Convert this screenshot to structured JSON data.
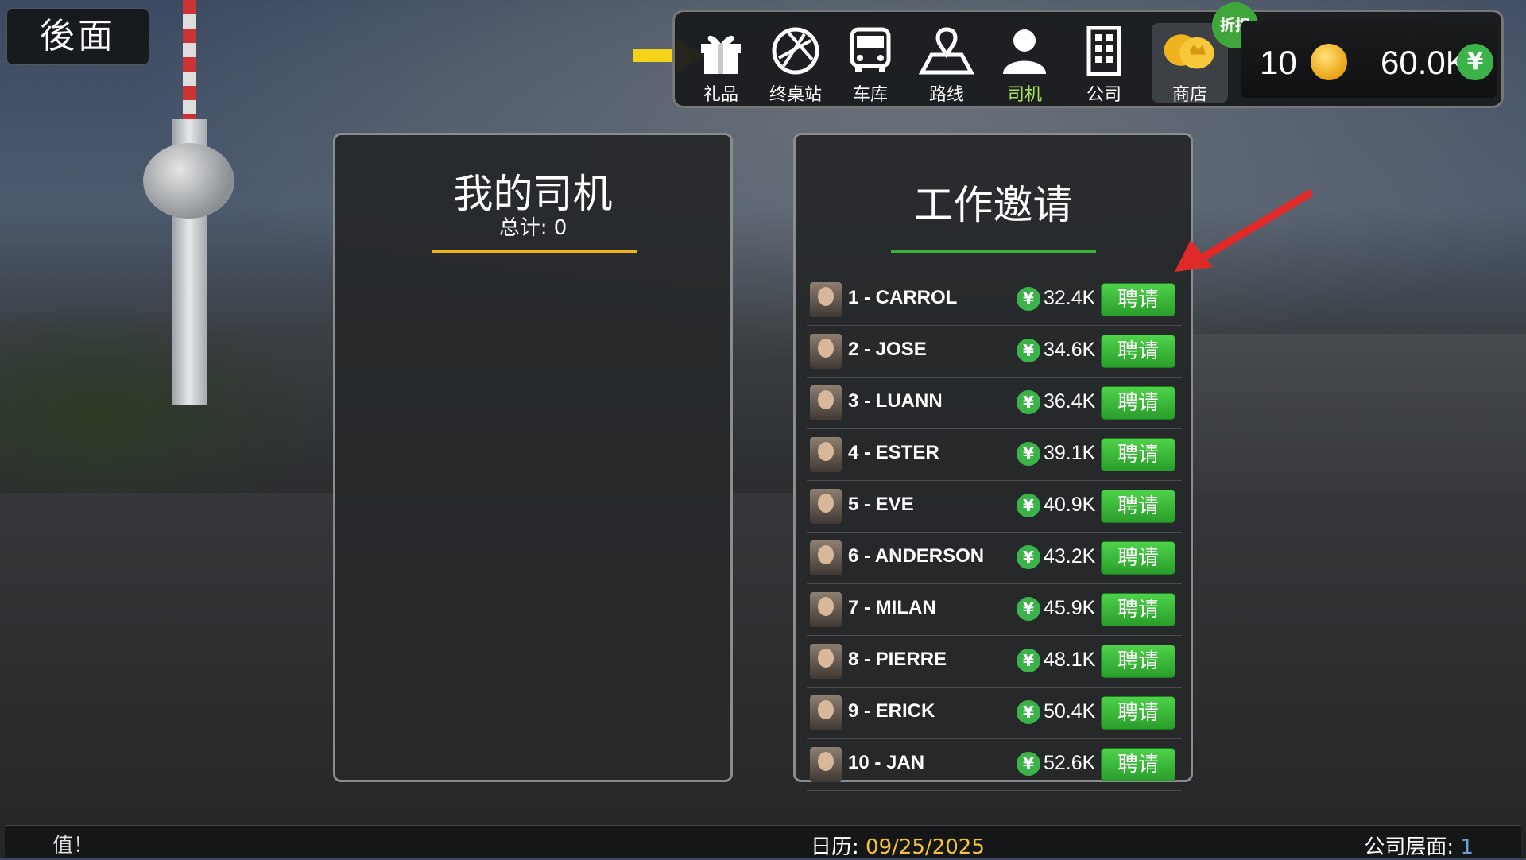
{
  "back_button": {
    "label": "後面"
  },
  "nav": {
    "items": [
      {
        "label": "礼品",
        "icon": "gift-icon"
      },
      {
        "label": "终桌站",
        "icon": "terminal-globe-icon"
      },
      {
        "label": "车库",
        "icon": "bus-icon"
      },
      {
        "label": "路线",
        "icon": "route-map-icon"
      },
      {
        "label": "司机",
        "icon": "driver-icon",
        "active": true
      },
      {
        "label": "公司",
        "icon": "company-building-icon"
      },
      {
        "label": "商店",
        "icon": "coins-icon"
      }
    ],
    "discount_badge": "折扣",
    "coins": "10",
    "money": "60.0K",
    "yen_symbol": "¥"
  },
  "my_drivers": {
    "title": "我的司机",
    "total_label": "总计: 0"
  },
  "job_offers": {
    "title": "工作邀请",
    "hire_label": "聘请",
    "rows": [
      {
        "name": "1 - CARROL",
        "salary": "32.4K"
      },
      {
        "name": "2 - JOSE",
        "salary": "34.6K"
      },
      {
        "name": "3 - LUANN",
        "salary": "36.4K"
      },
      {
        "name": "4 - ESTER",
        "salary": "39.1K"
      },
      {
        "name": "5 - EVE",
        "salary": "40.9K"
      },
      {
        "name": "6 - ANDERSON",
        "salary": "43.2K"
      },
      {
        "name": "7 - MILAN",
        "salary": "45.9K"
      },
      {
        "name": "8 - PIERRE",
        "salary": "48.1K"
      },
      {
        "name": "9 - ERICK",
        "salary": "50.4K"
      },
      {
        "name": "10 - JAN",
        "salary": "52.6K"
      }
    ]
  },
  "status_bar": {
    "left_text": "值！",
    "calendar_label": "日历: ",
    "date": "09/25/2025",
    "company_level_label": "公司层面: ",
    "company_level": "1"
  },
  "colors": {
    "accent_green": "#3cb34a",
    "active_nav": "#a8e25a",
    "date_yellow": "#f3c33a",
    "left_underline": "#f0b41e",
    "right_underline": "#3fae3a"
  }
}
